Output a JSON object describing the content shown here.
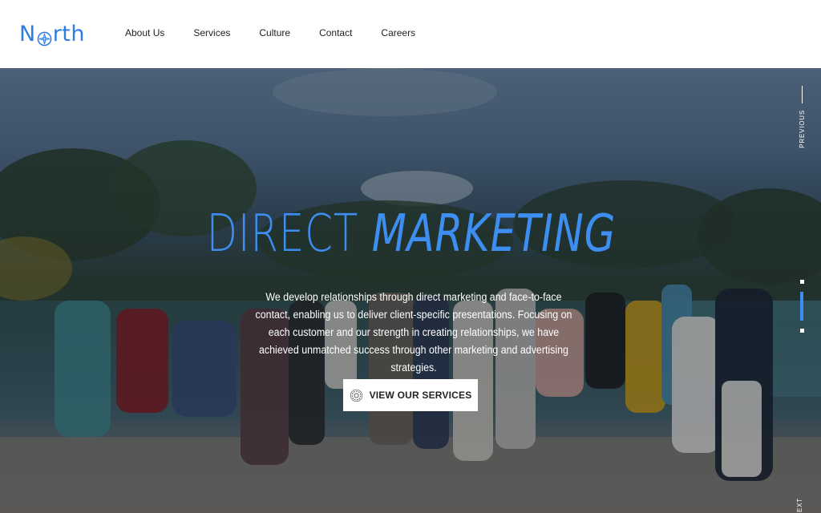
{
  "brand": {
    "logo_text_before": "N",
    "logo_text_after": "rth",
    "logo_icon": "compass-icon",
    "accent_color": "#3d8ef0"
  },
  "nav": {
    "items": [
      {
        "label": "About Us"
      },
      {
        "label": "Services"
      },
      {
        "label": "Culture"
      },
      {
        "label": "Contact"
      },
      {
        "label": "Careers"
      }
    ]
  },
  "hero": {
    "title_word1": "DIRECT",
    "title_word2": "MARKETING",
    "description": "We develop relationships through direct marketing and face-to-face contact, enabling us to deliver client-specific presentations. Focusing on each customer and our strength in creating relationships, we have achieved unmatched success through other marketing and advertising strategies.",
    "cta_label": "VIEW OUR SERVICES",
    "cta_icon": "gear-icon"
  },
  "slider": {
    "previous_label": "PREVIOUS",
    "next_label": "NEXT",
    "active_index": 2,
    "total_slides": 3
  }
}
